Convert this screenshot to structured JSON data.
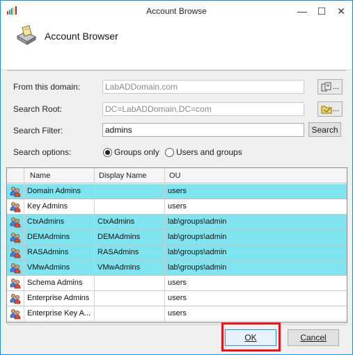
{
  "window": {
    "title": "Account Browse",
    "controls": {
      "minimize": "—",
      "maximize": "☐",
      "close": "✕"
    }
  },
  "banner": {
    "title": "Account Browser"
  },
  "form": {
    "domain_label": "From this domain:",
    "domain_value": "LabADDomain.com",
    "root_label": "Search Root:",
    "root_value": "DC=LabADDomain,DC=com",
    "filter_label": "Search Filter:",
    "filter_value": "admins",
    "search_button": "Search",
    "pick_button_label": "...",
    "options_label": "Search options:",
    "option_groups_only": "Groups only",
    "option_users_and_groups": "Users and groups"
  },
  "grid": {
    "columns": [
      "Name",
      "Display Name",
      "OU"
    ],
    "rows": [
      {
        "name": "Domain Admins",
        "display": "",
        "ou": "users"
      },
      {
        "name": "Key Admins",
        "display": "",
        "ou": "users"
      },
      {
        "name": "CtxAdmins",
        "display": "CtxAdmins",
        "ou": "lab\\groups\\admin"
      },
      {
        "name": "DEMAdmins",
        "display": "DEMAdmins",
        "ou": "lab\\groups\\admin"
      },
      {
        "name": "RASAdmins",
        "display": "RASAdmins",
        "ou": "lab\\groups\\admin"
      },
      {
        "name": "VMwAdmins",
        "display": "VMwAdmins",
        "ou": "lab\\groups\\admin"
      },
      {
        "name": "Schema Admins",
        "display": "",
        "ou": "users"
      },
      {
        "name": "Enterprise Admins",
        "display": "",
        "ou": "users"
      },
      {
        "name": "Enterprise Key A...",
        "display": "",
        "ou": "users"
      }
    ]
  },
  "footer": {
    "ok": "OK",
    "cancel": "Cancel"
  },
  "colors": {
    "selected_row": "#7fe4f0",
    "highlight_frame": "#e3141c",
    "accent": "#1e8cd6"
  }
}
